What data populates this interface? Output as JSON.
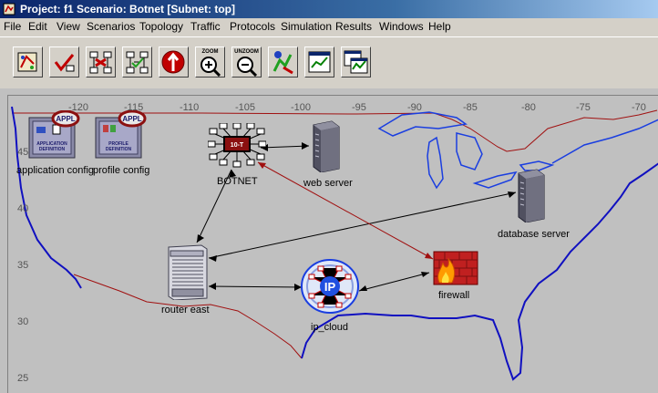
{
  "window": {
    "title": "Project: f1 Scenario: Botnet  [Subnet: top]"
  },
  "menu": [
    "File",
    "Edit",
    "View",
    "Scenarios",
    "Topology",
    "Traffic",
    "Protocols",
    "Simulation",
    "Results",
    "Windows",
    "Help"
  ],
  "toolbar": {
    "zoom_label": "ZOOM",
    "unzoom_label": "UNZOOM"
  },
  "axes": {
    "x_ticks": [
      "-120",
      "-115",
      "-110",
      "-105",
      "-100",
      "-95",
      "-90",
      "-85",
      "-80",
      "-75",
      "-70"
    ],
    "y_ticks": [
      "45",
      "40",
      "35",
      "30",
      "25"
    ]
  },
  "nodes": {
    "app_config": {
      "label": "application config",
      "badge": "APPL",
      "line1": "APPLICATION",
      "line2": "DEFINITION"
    },
    "profile_config": {
      "label": "profile config",
      "badge": "APPL",
      "line1": "PROFILE",
      "line2": "DEFINITION"
    },
    "botnet": {
      "label": "BOTNET",
      "center_text": "10-T"
    },
    "web_server": {
      "label": "web server"
    },
    "database_server": {
      "label": "database server"
    },
    "router_east": {
      "label": "router east"
    },
    "ip_cloud": {
      "label": "ip_cloud",
      "center_text": "IP"
    },
    "firewall": {
      "label": "firewall"
    }
  },
  "colors": {
    "border_line": "#a01010",
    "water": "#1a3ee0",
    "coast": "#1010c0",
    "link_black": "#000000",
    "link_red": "#a01010"
  }
}
